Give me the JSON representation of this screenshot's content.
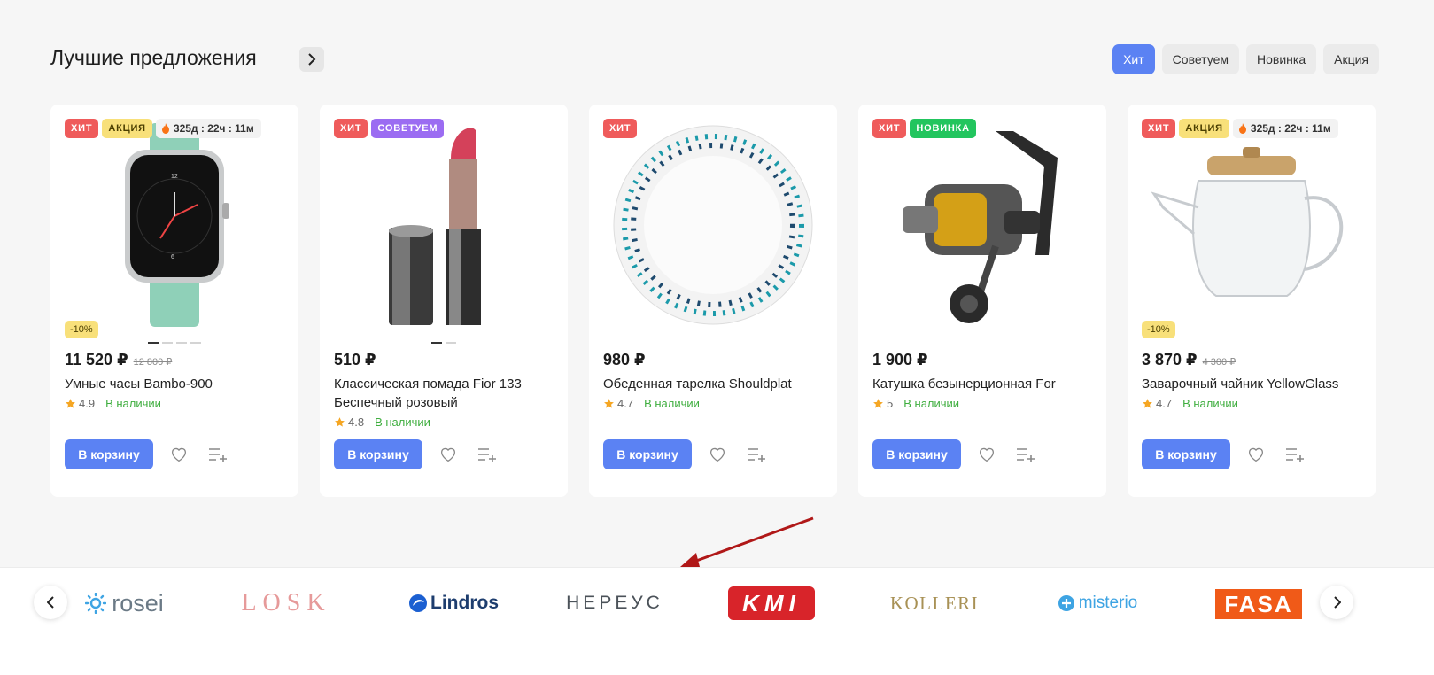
{
  "section": {
    "title": "Лучшие предложения",
    "tabs": [
      {
        "label": "Хит",
        "active": true
      },
      {
        "label": "Советуем",
        "active": false
      },
      {
        "label": "Новинка",
        "active": false
      },
      {
        "label": "Акция",
        "active": false
      }
    ]
  },
  "products": [
    {
      "badges": [
        "Хит",
        "Акция"
      ],
      "timer": "325д : 22ч : 11м",
      "discount": "-10%",
      "price": "11 520 ₽",
      "old_price": "12 800 ₽",
      "name": "Умные часы Bambo-900",
      "rating": "4.9",
      "stock": "В наличии",
      "image_icon": "smartwatch-image"
    },
    {
      "badges": [
        "Хит",
        "Советуем"
      ],
      "price": "510 ₽",
      "name": "Классическая помада Fior 133 Беспечный розовый",
      "rating": "4.8",
      "stock": "В наличии",
      "image_icon": "lipstick-image"
    },
    {
      "badges": [
        "Хит"
      ],
      "price": "980 ₽",
      "name": "Обеденная тарелка Shouldplat",
      "rating": "4.7",
      "stock": "В наличии",
      "image_icon": "plate-image"
    },
    {
      "badges": [
        "Хит",
        "Новинка"
      ],
      "price": "1 900 ₽",
      "name": "Катушка безынерционная For",
      "rating": "5",
      "stock": "В наличии",
      "image_icon": "fishing-reel-image"
    },
    {
      "badges": [
        "Хит",
        "Акция"
      ],
      "timer": "325д : 22ч : 11м",
      "discount": "-10%",
      "price": "3 870 ₽",
      "old_price": "4 300 ₽",
      "name": "Заварочный чайник YellowGlass",
      "rating": "4.7",
      "stock": "В наличии",
      "image_icon": "teapot-image"
    }
  ],
  "cart_label": "В корзину",
  "brands": [
    "rosei",
    "LOSK",
    "Lindros",
    "НЕРЕУС",
    "KMI",
    "KOLLERI",
    "misterio",
    "FASA"
  ],
  "colors": {
    "accent": "#5b82f3",
    "hit": "#ef5b5b",
    "sale": "#f8e07a",
    "recommend": "#9b6cf2",
    "new": "#22c55e",
    "stock": "#3fae3f",
    "annotation_arrow": "#b01818"
  }
}
